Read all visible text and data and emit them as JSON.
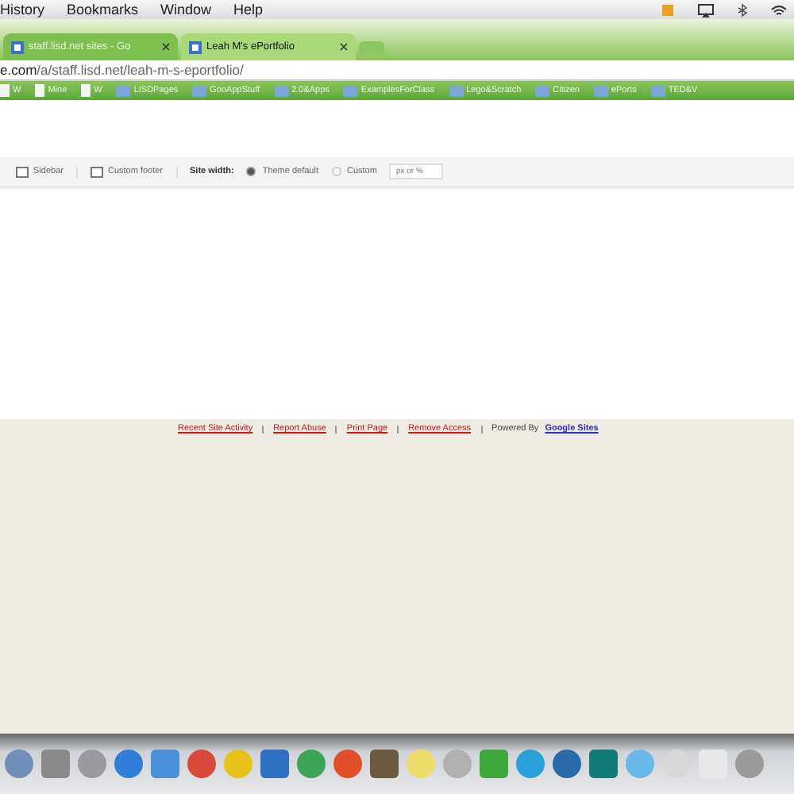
{
  "menu_bar": {
    "items": [
      "History",
      "Bookmarks",
      "Window",
      "Help"
    ]
  },
  "tabs": [
    {
      "label": "staff.lisd.net sites - Go",
      "selected": false
    },
    {
      "label": "Leah M's ePortfolio",
      "selected": true
    }
  ],
  "address_bar": {
    "host": "e.com",
    "path": "/a/staff.lisd.net/leah-m-s-eportfolio/"
  },
  "bookmarks": [
    {
      "label": "W",
      "kind": "page"
    },
    {
      "label": "Mine",
      "kind": "page"
    },
    {
      "label": "W",
      "kind": "page"
    },
    {
      "label": "LISDPages",
      "kind": "folder"
    },
    {
      "label": "GooAppStuff",
      "kind": "folder"
    },
    {
      "label": "2.0&Apps",
      "kind": "folder"
    },
    {
      "label": "ExamplesForClass",
      "kind": "folder"
    },
    {
      "label": "Lego&Scratch",
      "kind": "folder"
    },
    {
      "label": "Citizen",
      "kind": "folder"
    },
    {
      "label": "ePorts",
      "kind": "folder"
    },
    {
      "label": "TED&V",
      "kind": "folder"
    }
  ],
  "layout_toolbar": {
    "options": [
      {
        "label": "Sidebar"
      },
      {
        "label": "Custom footer"
      }
    ],
    "site_width_label": "Site width:",
    "radios": [
      {
        "label": "Theme default",
        "selected": true
      },
      {
        "label": "Custom",
        "selected": false
      }
    ],
    "custom_placeholder": "px or %"
  },
  "footer": {
    "links": [
      "Recent Site Activity",
      "Report Abuse",
      "Print Page",
      "Remove Access"
    ],
    "powered_by": "Powered By",
    "brand_link": "Google Sites"
  },
  "dock": {
    "apps": [
      {
        "color": "#6f8fb8"
      },
      {
        "color": "#8a8a8a"
      },
      {
        "color": "#9a9aa0"
      },
      {
        "color": "#2f7fd8"
      },
      {
        "color": "#4a90d9"
      },
      {
        "color": "#d94a3a"
      },
      {
        "color": "#e8c21a"
      },
      {
        "color": "#2f6fc0"
      },
      {
        "color": "#3aa655"
      },
      {
        "color": "#e0502a"
      },
      {
        "color": "#6b5a40"
      },
      {
        "color": "#f0dc6a"
      },
      {
        "color": "#b0b0b0"
      },
      {
        "color": "#3fa83a"
      },
      {
        "color": "#2aa0d8"
      },
      {
        "color": "#2a6aa8"
      },
      {
        "color": "#147a78"
      },
      {
        "color": "#6ab8e8"
      },
      {
        "color": "#d8d8d8"
      },
      {
        "color": "#e8e8e8"
      },
      {
        "color": "#9a9a9a"
      }
    ]
  }
}
